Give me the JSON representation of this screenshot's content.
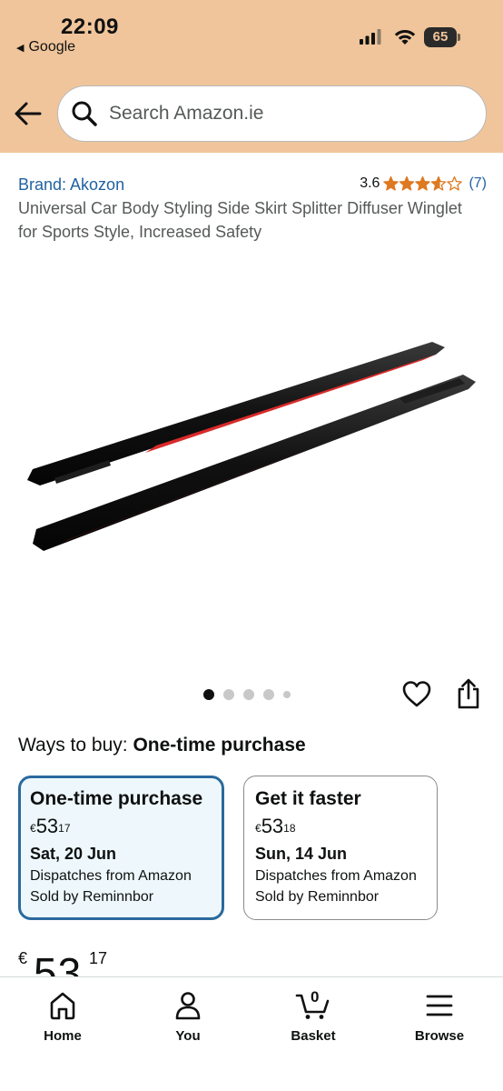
{
  "status_bar": {
    "time": "22:09",
    "back_app": "Google",
    "battery": "65",
    "battery_level": 0.65
  },
  "search": {
    "placeholder": "Search Amazon.ie"
  },
  "product": {
    "brand": "Brand: Akozon",
    "rating_value": "3.6",
    "rating_stars": 3.6,
    "rating_count": "(7)",
    "title": "Universal Car Body Styling Side Skirt Splitter Diffuser Winglet for Sports Style, Increased Safety",
    "image_count": 5,
    "active_image": 1
  },
  "ways_to_buy": {
    "label": "Ways to buy:",
    "selected": "One-time purchase"
  },
  "options": [
    {
      "title": "One-time purchase",
      "currency": "€",
      "price_whole": "53",
      "price_fraction": "17",
      "date": "Sat, 20 Jun",
      "dispatch": "Dispatches from Amazon",
      "seller": "Sold by Reminnbor"
    },
    {
      "title": "Get it faster",
      "currency": "€",
      "price_whole": "53",
      "price_fraction": "18",
      "date": "Sun, 14 Jun",
      "dispatch": "Dispatches from Amazon",
      "seller": "Sold by Reminnbor"
    }
  ],
  "price": {
    "currency": "€",
    "whole": "53",
    "fraction": "17"
  },
  "bottom_nav": {
    "home": "Home",
    "you": "You",
    "basket": "Basket",
    "basket_count": "0",
    "browse": "Browse"
  },
  "colors": {
    "header_bg": "#f0c59b",
    "link": "#2162a1",
    "selected_border": "#2a6a9e",
    "selected_bg": "#eef8fc",
    "star": "#de7921"
  }
}
